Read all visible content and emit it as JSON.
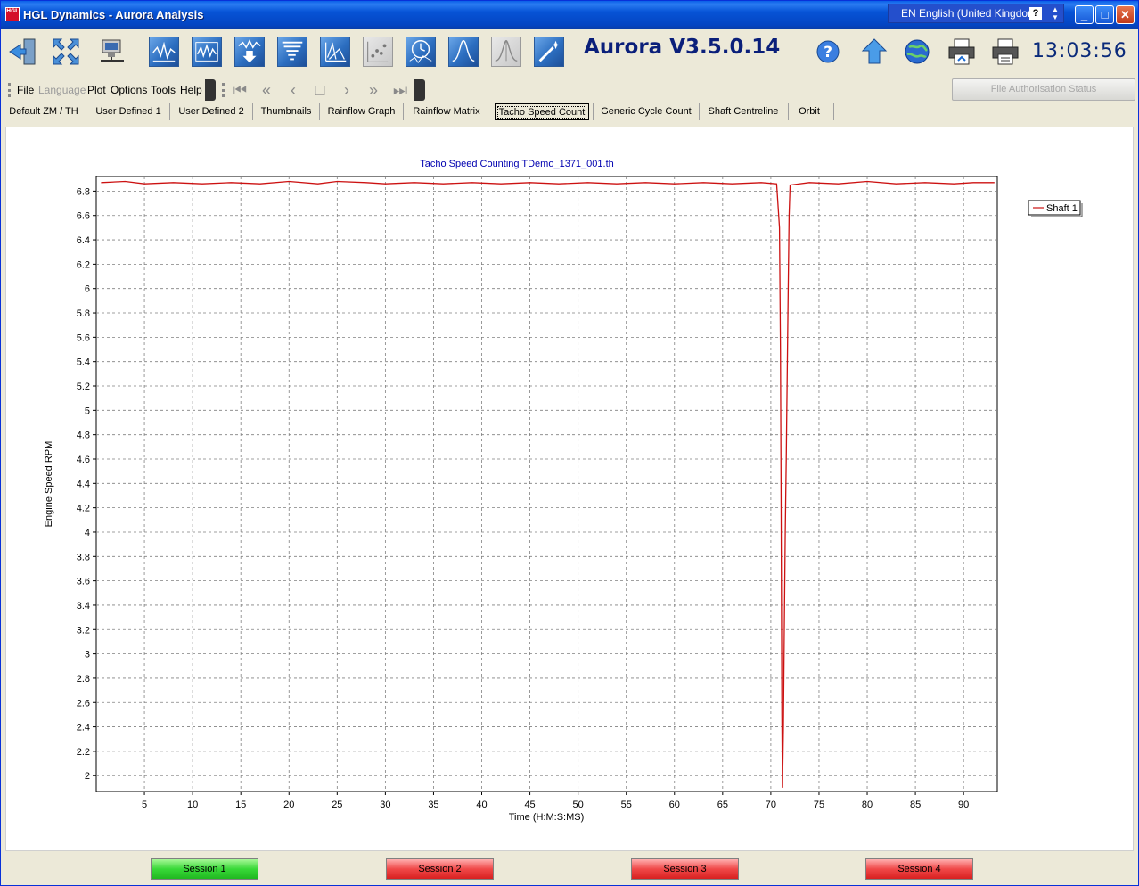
{
  "window": {
    "title": "HGL Dynamics - Aurora Analysis",
    "icon_text": "HGL",
    "language": "EN English (United Kingdom)",
    "help_glyph": "?",
    "controls": [
      "minimize-icon",
      "maximize-icon",
      "close-icon"
    ]
  },
  "toolbar": {
    "version": "Aurora V3.5.0.14",
    "clock": "13:03:56",
    "icons": [
      "exit-icon",
      "fullscreen-icon",
      "network-icon",
      "waveform-icon",
      "spectrum-icon",
      "download-wave-icon",
      "tornado-icon",
      "waterfall-icon",
      "scatter-icon",
      "clock-wave-icon",
      "peak-icon",
      "bell-curve-icon",
      "magic-wand-icon",
      "help-icon",
      "upload-icon",
      "globe-icon",
      "print-icon",
      "print-preview-icon"
    ]
  },
  "menu": {
    "items": [
      {
        "label": "File",
        "enabled": true
      },
      {
        "label": "Language",
        "enabled": false
      },
      {
        "label": "Plot",
        "enabled": true
      },
      {
        "label": "Options",
        "enabled": true
      },
      {
        "label": "Tools",
        "enabled": true
      },
      {
        "label": "Help",
        "enabled": true
      }
    ],
    "auth_button": "File Authorisation Status"
  },
  "tabs": [
    {
      "label": "Default ZM / TH"
    },
    {
      "label": "User Defined 1"
    },
    {
      "label": "User Defined 2"
    },
    {
      "label": "Thumbnails"
    },
    {
      "label": "Rainflow Graph"
    },
    {
      "label": "Rainflow Matrix"
    },
    {
      "label": "Tacho Speed Count",
      "active": true
    },
    {
      "label": "Generic Cycle Count"
    },
    {
      "label": "Shaft Centreline"
    },
    {
      "label": "Orbit"
    }
  ],
  "sessions": [
    {
      "label": "Session 1",
      "color": "#22c022"
    },
    {
      "label": "Session 2",
      "color": "#e02828"
    },
    {
      "label": "Session 3",
      "color": "#e02828"
    },
    {
      "label": "Session 4",
      "color": "#e02828"
    }
  ],
  "chart_data": {
    "type": "line",
    "title": "Tacho Speed Counting TDemo_1371_001.th",
    "xlabel": "Time (H:M:S:MS)",
    "ylabel": "Engine Speed RPM",
    "xlim": [
      0,
      93.5
    ],
    "ylim": [
      1.87,
      6.92
    ],
    "xticks": [
      5,
      10,
      15,
      20,
      25,
      30,
      35,
      40,
      45,
      50,
      55,
      60,
      65,
      70,
      75,
      80,
      85,
      90
    ],
    "yticks": [
      2,
      2.2,
      2.4,
      2.6,
      2.8,
      3,
      3.2,
      3.4,
      3.6,
      3.8,
      4,
      4.2,
      4.4,
      4.6,
      4.8,
      5,
      5.2,
      5.4,
      5.6,
      5.8,
      6,
      6.2,
      6.4,
      6.6,
      6.8
    ],
    "grid": true,
    "legend_position": "top-right",
    "series": [
      {
        "name": "Shaft 1",
        "color": "#cc1111",
        "points": [
          [
            0.5,
            6.87
          ],
          [
            3,
            6.88
          ],
          [
            5,
            6.86
          ],
          [
            8,
            6.87
          ],
          [
            11,
            6.86
          ],
          [
            14,
            6.87
          ],
          [
            17,
            6.86
          ],
          [
            20,
            6.88
          ],
          [
            23,
            6.86
          ],
          [
            25,
            6.88
          ],
          [
            28,
            6.87
          ],
          [
            30,
            6.86
          ],
          [
            33,
            6.87
          ],
          [
            36,
            6.86
          ],
          [
            39,
            6.87
          ],
          [
            42,
            6.86
          ],
          [
            45,
            6.87
          ],
          [
            48,
            6.86
          ],
          [
            51,
            6.87
          ],
          [
            54,
            6.86
          ],
          [
            57,
            6.87
          ],
          [
            60,
            6.86
          ],
          [
            63,
            6.87
          ],
          [
            66,
            6.86
          ],
          [
            69,
            6.87
          ],
          [
            70.6,
            6.86
          ],
          [
            70.9,
            6.5
          ],
          [
            71.0,
            5.5
          ],
          [
            71.05,
            4.5
          ],
          [
            71.1,
            3.5
          ],
          [
            71.15,
            2.5
          ],
          [
            71.2,
            1.9
          ],
          [
            71.25,
            2.1
          ],
          [
            71.3,
            2.4
          ],
          [
            71.4,
            3.2
          ],
          [
            71.5,
            4.0
          ],
          [
            71.6,
            4.6
          ],
          [
            71.7,
            5.3
          ],
          [
            71.8,
            6.0
          ],
          [
            71.9,
            6.6
          ],
          [
            72.0,
            6.85
          ],
          [
            74,
            6.87
          ],
          [
            77,
            6.86
          ],
          [
            80,
            6.88
          ],
          [
            83,
            6.86
          ],
          [
            86,
            6.87
          ],
          [
            89,
            6.86
          ],
          [
            91,
            6.87
          ],
          [
            93.2,
            6.87
          ]
        ]
      }
    ]
  }
}
